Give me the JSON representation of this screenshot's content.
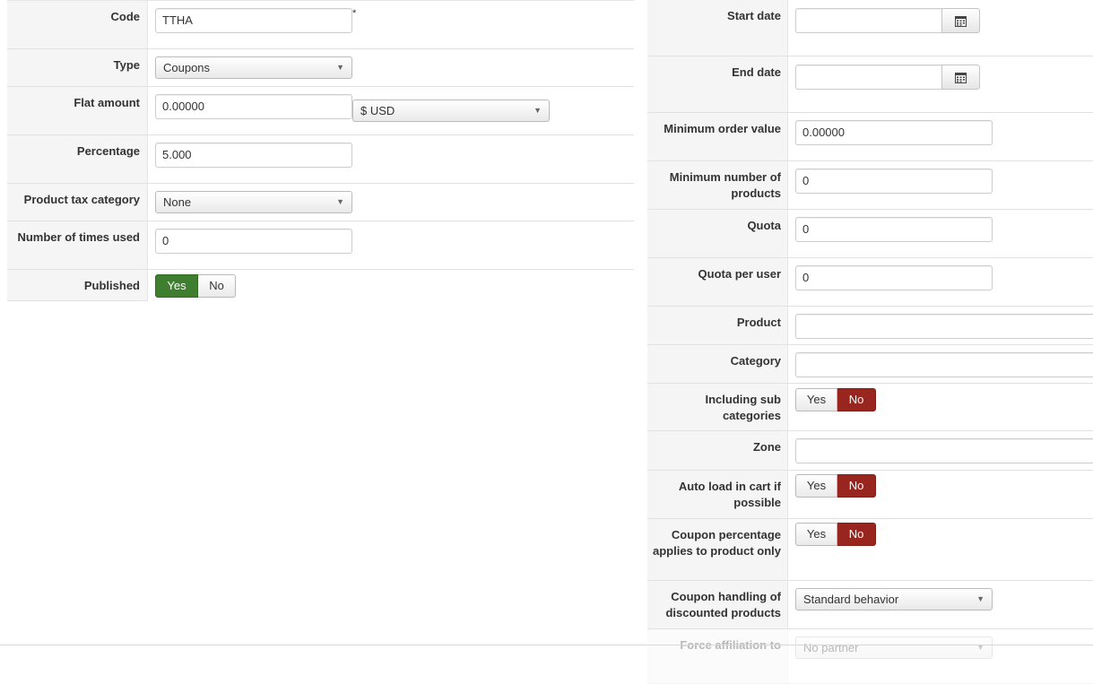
{
  "left": {
    "code": {
      "label": "Code",
      "value": "TTHA",
      "required_mark": "*"
    },
    "type": {
      "label": "Type",
      "value": "Coupons"
    },
    "flat_amount": {
      "label": "Flat amount",
      "value": "0.00000",
      "currency": "$ USD"
    },
    "percentage": {
      "label": "Percentage",
      "value": "5.000"
    },
    "product_tax_category": {
      "label": "Product tax category",
      "value": "None"
    },
    "times_used": {
      "label": "Number of times used",
      "value": "0"
    },
    "published": {
      "label": "Published",
      "yes": "Yes",
      "no": "No",
      "selected": "Yes"
    }
  },
  "right": {
    "start_date": {
      "label": "Start date",
      "value": ""
    },
    "end_date": {
      "label": "End date",
      "value": ""
    },
    "min_order_value": {
      "label": "Minimum order value",
      "value": "0.00000"
    },
    "min_products": {
      "label": "Minimum number of products",
      "value": "0"
    },
    "quota": {
      "label": "Quota",
      "value": "0"
    },
    "quota_per_user": {
      "label": "Quota per user",
      "value": "0"
    },
    "product": {
      "label": "Product",
      "value": ""
    },
    "category": {
      "label": "Category",
      "value": ""
    },
    "including_sub": {
      "label": "Including sub categories",
      "yes": "Yes",
      "no": "No",
      "selected": "No"
    },
    "zone": {
      "label": "Zone",
      "value": ""
    },
    "auto_load": {
      "label": "Auto load in cart if possible",
      "yes": "Yes",
      "no": "No",
      "selected": "No"
    },
    "coupon_pct_product": {
      "label": "Coupon percentage applies to product only",
      "yes": "Yes",
      "no": "No",
      "selected": "No"
    },
    "discounted_handling": {
      "label": "Coupon handling of discounted products",
      "value": "Standard behavior"
    },
    "force_affiliation": {
      "label": "Force affiliation to",
      "value": "No partner"
    }
  },
  "colors": {
    "yes_active": "#3e7e2e",
    "no_active": "#98261f",
    "label_bg": "#f5f5f5"
  },
  "icons": {
    "calendar": "calendar-icon",
    "dropdown": "chevron-down-icon"
  }
}
